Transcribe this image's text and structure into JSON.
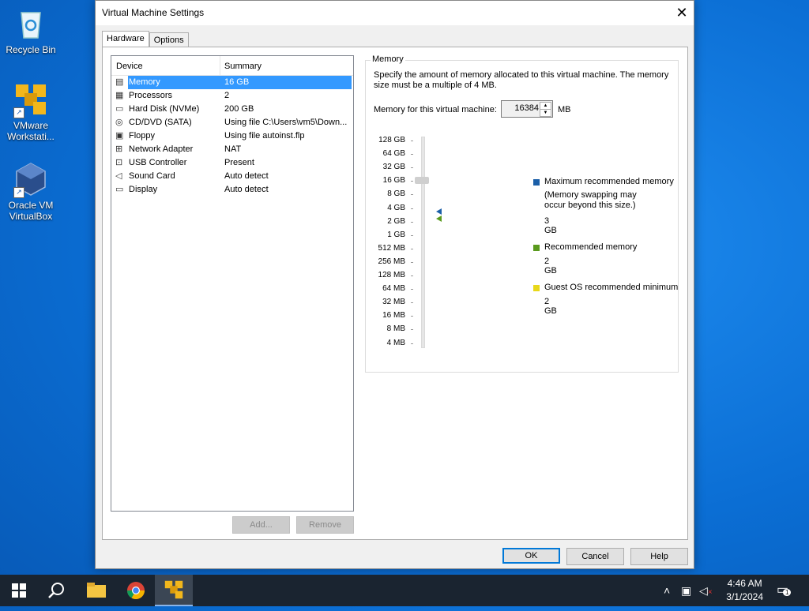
{
  "desktop": {
    "icons": [
      {
        "label": "Recycle Bin",
        "icon": "recycle-bin-icon"
      },
      {
        "label": "VMware Workstati...",
        "icon": "vmware-icon"
      },
      {
        "label": "Oracle VM VirtualBox",
        "icon": "virtualbox-icon"
      }
    ]
  },
  "dialog": {
    "title": "Virtual Machine Settings",
    "close_glyph": "✕",
    "tabs": [
      "Hardware",
      "Options"
    ],
    "device_list": {
      "col_device": "Device",
      "col_summary": "Summary",
      "rows": [
        {
          "name": "Memory",
          "summary": "16 GB",
          "icon": "memory-icon",
          "selected": true
        },
        {
          "name": "Processors",
          "summary": "2",
          "icon": "processor-icon"
        },
        {
          "name": "Hard Disk (NVMe)",
          "summary": "200 GB",
          "icon": "hard-disk-icon"
        },
        {
          "name": "CD/DVD (SATA)",
          "summary": "Using file C:\\Users\\vm5\\Down...",
          "icon": "cd-dvd-icon"
        },
        {
          "name": "Floppy",
          "summary": "Using file autoinst.flp",
          "icon": "floppy-icon"
        },
        {
          "name": "Network Adapter",
          "summary": "NAT",
          "icon": "network-adapter-icon"
        },
        {
          "name": "USB Controller",
          "summary": "Present",
          "icon": "usb-icon"
        },
        {
          "name": "Sound Card",
          "summary": "Auto detect",
          "icon": "sound-icon"
        },
        {
          "name": "Display",
          "summary": "Auto detect",
          "icon": "display-icon"
        }
      ]
    },
    "add_label": "Add...",
    "remove_label": "Remove",
    "memory": {
      "group_label": "Memory",
      "description": "Specify the amount of memory allocated to this virtual machine. The memory size must be a multiple of 4 MB.",
      "field_label": "Memory for this virtual machine:",
      "value": "16384",
      "unit": "MB",
      "scale": [
        "128 GB",
        "64 GB",
        "32 GB",
        "16 GB",
        "8 GB",
        "4 GB",
        "2 GB",
        "1 GB",
        "512 MB",
        "256 MB",
        "128 MB",
        "64 MB",
        "32 MB",
        "16 MB",
        "8 MB",
        "4 MB"
      ],
      "legend": {
        "max_title": "Maximum recommended memory",
        "max_note_1": "(Memory swapping may",
        "max_note_2": "occur beyond this size.)",
        "max_value": "3 GB",
        "rec_title": "Recommended memory",
        "rec_value": "2 GB",
        "min_title": "Guest OS recommended minimum",
        "min_value": "2 GB"
      },
      "colors": {
        "max": "#1b5fa8",
        "rec": "#5a9a1e",
        "min": "#e8d81a"
      }
    },
    "ok_label": "OK",
    "cancel_label": "Cancel",
    "help_label": "Help"
  },
  "taskbar": {
    "time": "4:46 AM",
    "date": "3/1/2024",
    "notification_count": "1"
  }
}
